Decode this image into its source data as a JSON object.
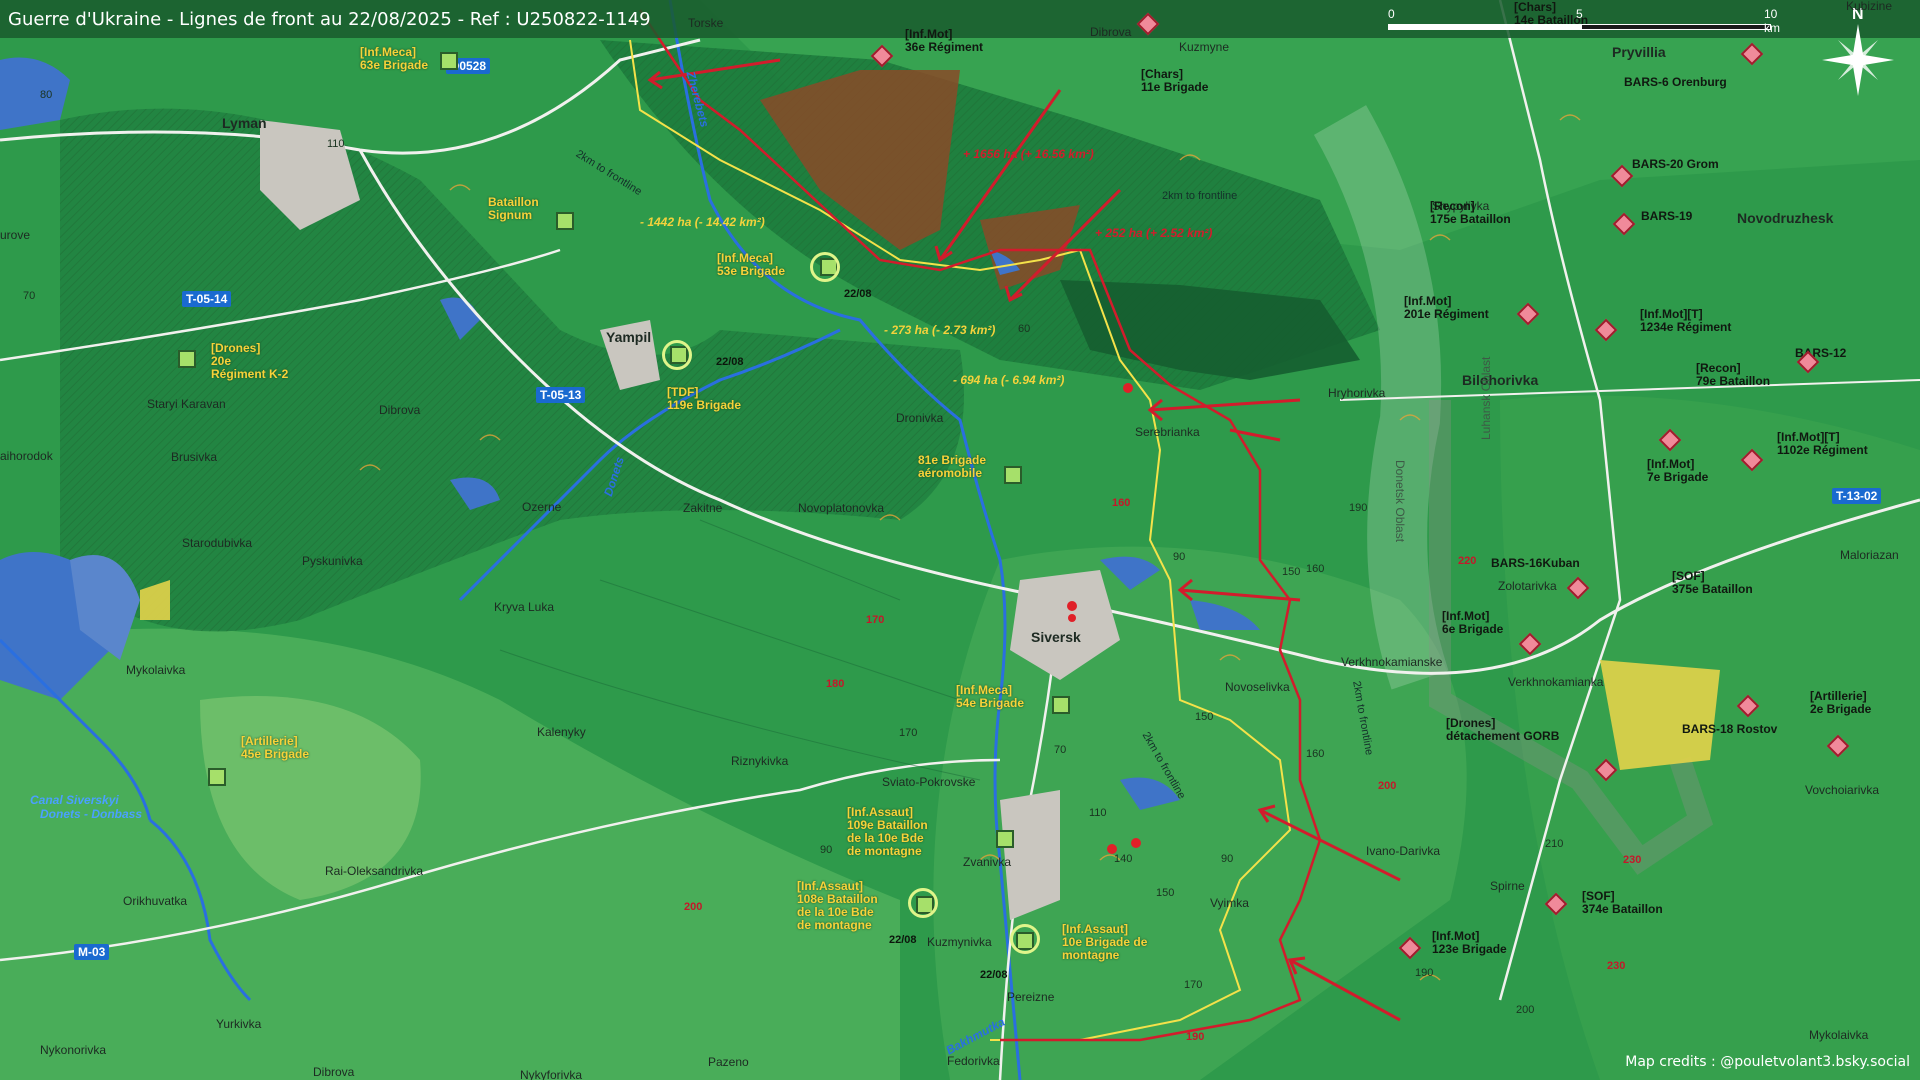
{
  "title": "Guerre d'Ukraine - Lignes de front au 22/08/2025 - Ref : U250822-1149",
  "scale": {
    "t0": "0",
    "t5": "5",
    "t10": "10 km"
  },
  "compass": "N",
  "credits": "Map credits : @pouletvolant3.bsky.social",
  "colors": {
    "ua_unit": "#f7d23a",
    "ru_front": "#d21c2c",
    "ua_front": "#f4e24a",
    "water": "#3f74c8",
    "road_badge": "#1a6ad0"
  },
  "roads": {
    "o0528": "O0528",
    "t0514": "T-05-14",
    "t0513": "T-05-13",
    "t1302": "T-13-02",
    "m03": "M-03"
  },
  "towns": {
    "lyman": "Lyman",
    "yampil": "Yampil",
    "siversk": "Siversk",
    "bilohorivka": "Bilohorivka",
    "novodruzhesk": "Novodruzhesk",
    "pryvillia": "Pryvillia",
    "torske": "Torske",
    "dibrova_n": "Dibrova",
    "kuzmyne": "Kuzmyne",
    "serebrianka": "Serebrianka",
    "hryhorivka": "Hryhorivka",
    "dronivka": "Dronivka",
    "zakitne": "Zakitne",
    "novoplatonovka": "Novoplatonovka",
    "ozerne": "Ozerne",
    "starodubivka": "Starodubivka",
    "pyskunivka": "Pyskunivka",
    "kryva_luka": "Kryva Luka",
    "staryi_karavan": "Staryi Karavan",
    "brusivka": "Brusivka",
    "dibrova_w": "Dibrova",
    "mykolaivka": "Mykolaivka",
    "kalenyky": "Kalenyky",
    "riznykivka": "Riznykivka",
    "sviato_pokrovske": "Sviato-Pokrovske",
    "zvanivka": "Zvanivka",
    "kuzmynivka": "Kuzmynivka",
    "pereizne": "Pereizne",
    "fedorivka": "Fedorivka",
    "pazeno": "Pazeno",
    "rai_oleksandrivka": "Rai-Oleksandrivka",
    "orikhuvatka": "Orikhuvatka",
    "yurkivka": "Yurkivka",
    "nykonorivka": "Nykonorivka",
    "dibrova_s": "Dibrova",
    "nykyforivka": "Nykyforivka",
    "novoselivka": "Novoselivka",
    "verkhnokamianske": "Verkhnokamianske",
    "verkhnokamianka": "Verkhnokamianka",
    "ivano_darivka": "Ivano-Darivka",
    "vyimka": "Vyimka",
    "spirne": "Spirne",
    "zolotarivka": "Zolotarivka",
    "shypylivka": "Shypylivka",
    "vovchoiarivka": "Vovchoiarivka",
    "mykolaivka_e": "Mykolaivka",
    "maloriazan": "Maloriazan",
    "kubizine": "Kubizine",
    "urove": "urove",
    "aihorodok": "aihorodok"
  },
  "units_ua": {
    "u63": {
      "type": "[Inf.Meca]",
      "name": "63e Brigade"
    },
    "signum": {
      "type": "Bataillon",
      "name": "Signum"
    },
    "u53": {
      "type": "[Inf.Meca]",
      "name": "53e Brigade"
    },
    "k2": {
      "type": "[Drones]",
      "name": "20e",
      "name2": "Régiment K-2"
    },
    "u119": {
      "type": "[TDF]",
      "name": "119e Brigade"
    },
    "u81": {
      "type": "81e Brigade",
      "name": "aéromobile"
    },
    "u54": {
      "type": "[Inf.Meca]",
      "name": "54e Brigade"
    },
    "u45": {
      "type": "[Artillerie]",
      "name": "45e Brigade"
    },
    "u109": {
      "type": "[Inf.Assaut]",
      "name": "109e Bataillon",
      "name2": "de la 10e Bde",
      "name3": "de montagne"
    },
    "u108": {
      "type": "[Inf.Assaut]",
      "name": "108e Bataillon",
      "name2": "de la 10e Bde",
      "name3": "de montagne"
    },
    "u10": {
      "type": "[Inf.Assaut]",
      "name": "10e Brigade de",
      "name2": "montagne"
    }
  },
  "units_ru": {
    "r36": {
      "type": "[Inf.Mot]",
      "name": "36e Régiment"
    },
    "r11": {
      "type": "[Chars]",
      "name": "11e Brigade"
    },
    "r14": {
      "type": "[Chars]",
      "name": "14e Bataillon"
    },
    "bars6": "BARS-6 Orenburg",
    "bars20": "BARS-20 Grom",
    "bars19": "BARS-19",
    "r175": {
      "type": "[Recon]",
      "name": "175e Bataillon"
    },
    "r201": {
      "type": "[Inf.Mot]",
      "name": "201e Régiment"
    },
    "r1234": {
      "type": "[Inf.Mot][T]",
      "name": "1234e Régiment"
    },
    "bars12": "BARS-12",
    "r79": {
      "type": "[Recon]",
      "name": "79e Bataillon"
    },
    "r7": {
      "type": "[Inf.Mot]",
      "name": "7e Brigade"
    },
    "r1102": {
      "type": "[Inf.Mot][T]",
      "name": "1102e Régiment"
    },
    "bars16": "BARS-16Kuban",
    "r375": {
      "type": "[SOF]",
      "name": "375e Bataillon"
    },
    "r6": {
      "type": "[Inf.Mot]",
      "name": "6e Brigade"
    },
    "gorb": {
      "type": "[Drones]",
      "name": "détachement GORB"
    },
    "bars18": "BARS-18 Rostov",
    "r2a": {
      "type": "[Artillerie]",
      "name": "2e Brigade"
    },
    "r374": {
      "type": "[SOF]",
      "name": "374e Bataillon"
    },
    "r123": {
      "type": "[Inf.Mot]",
      "name": "123e Brigade"
    }
  },
  "areas": {
    "a1": "+ 1656 ha (+ 16.56 km²)",
    "a2": "+ 252 ha (+ 2.52 km²)",
    "a3": "- 1442 ha (- 14.42 km²)",
    "a4": "- 273 ha (- 2.73 km²)",
    "a5": "- 694 ha (- 6.94 km²)"
  },
  "dates": {
    "d1": "22/08",
    "d2": "22/08",
    "d3": "22/08",
    "d4": "22/08"
  },
  "frontline_text": {
    "f1": "2km to frontline",
    "f2": "2km to frontline",
    "f3": "2km to frontline",
    "f4": "2km to frontline"
  },
  "water": {
    "canal1": "Canal Siverskyi",
    "canal2": "Donets - Donbass",
    "zherebets": "Zherebets",
    "donets": "Donets",
    "bakhmutka": "Bakhmutka"
  },
  "oblast": {
    "donetsk": "Donetsk Oblast",
    "luhansk": "Luhansk Oblast"
  },
  "elevations": {
    "e80": "80",
    "e110": "110",
    "e70": "70",
    "e60": "60",
    "e160": "160",
    "e90": "90",
    "e170": "170",
    "e180": "180",
    "e200": "200",
    "e90b": "90",
    "e70b": "70",
    "e150": "150",
    "e150b": "150",
    "e160b": "160",
    "e190": "190",
    "e220": "220",
    "e160c": "160",
    "e200b": "200",
    "e210": "210",
    "e230": "230",
    "e230b": "230",
    "e190b": "190",
    "e200c": "200",
    "e170b": "170",
    "e190c": "190",
    "e140": "140",
    "e110b": "110",
    "e150c": "150",
    "e90c": "90",
    "e170c": "170"
  }
}
